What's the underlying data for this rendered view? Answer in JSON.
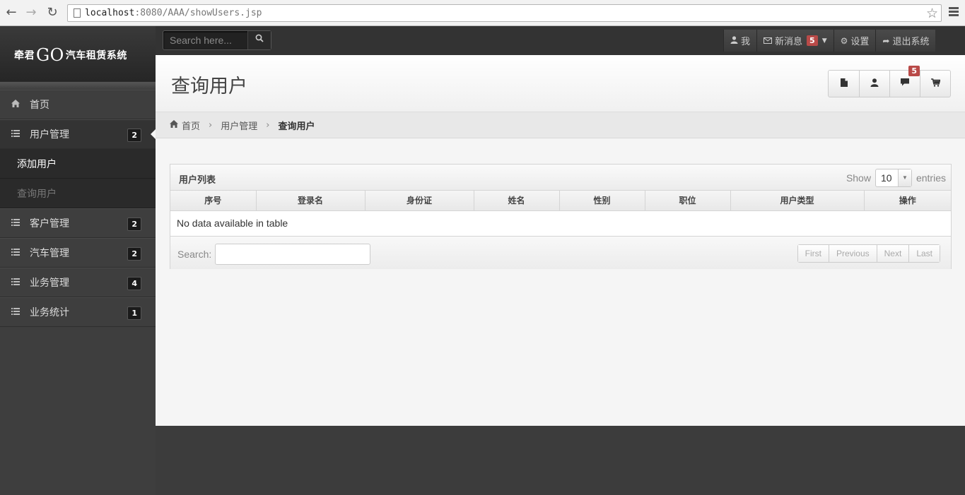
{
  "browser": {
    "url_host": "localhost",
    "url_path": ":8080/AAA/showUsers.jsp"
  },
  "brand": {
    "prefix": "牵君",
    "go": "GO",
    "suffix": "汽车租赁系统"
  },
  "top_search": {
    "placeholder": "Search here..."
  },
  "top_menu": {
    "me": "我",
    "messages": "新消息",
    "messages_count": "5",
    "settings": "设置",
    "logout": "退出系统"
  },
  "sidebar": {
    "items": [
      {
        "label": "首页"
      },
      {
        "label": "用户管理",
        "badge": "2"
      },
      {
        "label": "客户管理",
        "badge": "2"
      },
      {
        "label": "汽车管理",
        "badge": "2"
      },
      {
        "label": "业务管理",
        "badge": "4"
      },
      {
        "label": "业务统计",
        "badge": "1"
      }
    ],
    "sub_items": [
      {
        "label": "添加用户"
      },
      {
        "label": "查询用户"
      }
    ]
  },
  "page": {
    "title": "查询用户",
    "header_badge": "5"
  },
  "breadcrumb": {
    "home": "首页",
    "section": "用户管理",
    "current": "查询用户"
  },
  "panel": {
    "title": "用户列表",
    "show_label": "Show",
    "page_size": "10",
    "entries_label": "entries",
    "columns": [
      "序号",
      "登录名",
      "身份证",
      "姓名",
      "性别",
      "职位",
      "用户类型",
      "操作"
    ],
    "empty_message": "No data available in table",
    "search_label": "Search:",
    "pager": {
      "first": "First",
      "previous": "Previous",
      "next": "Next",
      "last": "Last"
    }
  }
}
